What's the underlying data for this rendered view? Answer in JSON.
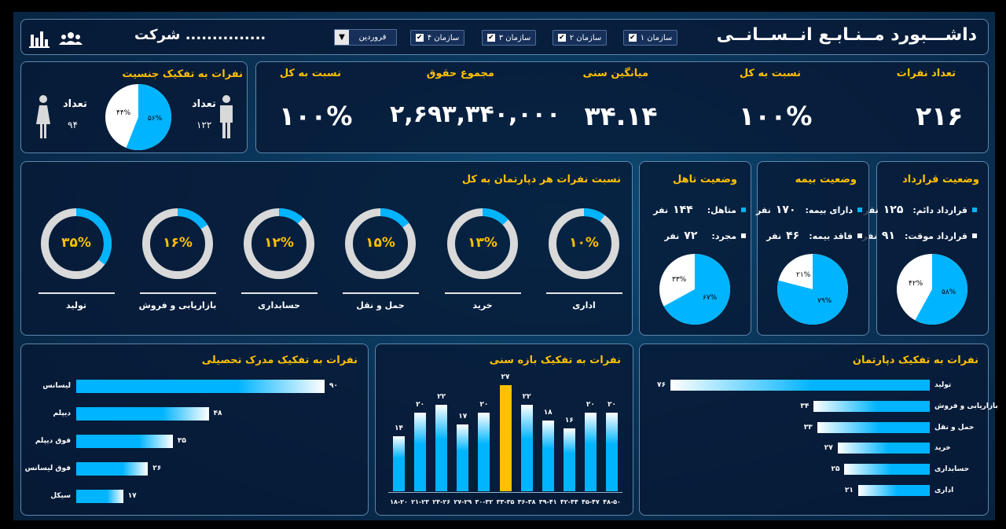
{
  "header": {
    "title": "داشـــبورد مــنـابـع انــســانــی",
    "company": "شرکت ...............",
    "org_filters": [
      {
        "label": "سازمان ۱"
      },
      {
        "label": "سازمان ۲"
      },
      {
        "label": "سازمان ۳"
      },
      {
        "label": "سازمان ۴"
      }
    ],
    "month": "فروردین",
    "icons": [
      "users-icon",
      "bar-chart-icon"
    ]
  },
  "gender": {
    "title": "نفرات به تفکیک جنسیت",
    "male_label": "تعداد",
    "male_count": "۱۲۲",
    "female_label": "تعداد",
    "female_count": "۹۴",
    "male_pct": "۵۶%",
    "female_pct": "۴۴%",
    "male_share": 0.56,
    "colors": {
      "male": "#00b4ff",
      "female": "#ffffff"
    }
  },
  "kpis": [
    {
      "label": "تعداد نفرات",
      "value": "۲۱۶"
    },
    {
      "label": "نسبت به کل",
      "value": "۱۰۰%"
    },
    {
      "label": "میانگین سنی",
      "value": "۳۴.۱۴"
    },
    {
      "label": "مجموع حقوق",
      "value": "۲,۶۹۳,۳۴۰,۰۰۰"
    },
    {
      "label": "نسبت به کل",
      "value": "۱۰۰%"
    }
  ],
  "departments_share": {
    "title": "نسبت نفرات هر دپارتمان به کل",
    "items": [
      {
        "label": "اداری",
        "pct": "۱۰%",
        "share": 0.1
      },
      {
        "label": "خرید",
        "pct": "۱۳%",
        "share": 0.13
      },
      {
        "label": "حمل و نقل",
        "pct": "۱۵%",
        "share": 0.15
      },
      {
        "label": "حسابداری",
        "pct": "۱۲%",
        "share": 0.12
      },
      {
        "label": "بازاریابی و فروش",
        "pct": "۱۶%",
        "share": 0.16
      },
      {
        "label": "تولید",
        "pct": "۳۵%",
        "share": 0.35
      }
    ]
  },
  "contract": {
    "title": "وضعیت قرارداد",
    "rows": [
      {
        "label": "قرارداد دائم:",
        "value": "۱۲۵",
        "unit": "نفر"
      },
      {
        "label": "قرارداد موقت:",
        "value": "۹۱",
        "unit": "نفر"
      }
    ],
    "pie": {
      "main_pct": "۵۸%",
      "rest_pct": "۴۲%",
      "main_share": 0.58
    }
  },
  "insurance": {
    "title": "وضعیت بیمه",
    "rows": [
      {
        "label": "دارای بیمه:",
        "value": "۱۷۰",
        "unit": "نفر"
      },
      {
        "label": "فاقد بیمه:",
        "value": "۴۶",
        "unit": "نفر"
      }
    ],
    "pie": {
      "main_pct": "۷۹%",
      "rest_pct": "۲۱%",
      "main_share": 0.79
    }
  },
  "marital": {
    "title": "وضعیت تاهل",
    "rows": [
      {
        "label": "متاهل:",
        "value": "۱۴۴",
        "unit": "نفر"
      },
      {
        "label": "مجرد:",
        "value": "۷۲",
        "unit": "نفر"
      }
    ],
    "pie": {
      "main_pct": "۶۷%",
      "rest_pct": "۳۳%",
      "main_share": 0.67
    }
  },
  "colors": {
    "accent": "#00b4ff",
    "gold": "#ffc000",
    "panel_border": "#5d86aa"
  },
  "chart_data": [
    {
      "type": "bar",
      "orientation": "horizontal",
      "title": "نفرات به تفکیک مدرک تحصیلی",
      "categories": [
        "لیسانس",
        "دیپلم",
        "فوق دیپلم",
        "فوق لیسانس",
        "سیکل"
      ],
      "values": [
        90,
        48,
        35,
        26,
        17
      ],
      "value_labels": [
        "۹۰",
        "۴۸",
        "۳۵",
        "۲۶",
        "۱۷"
      ]
    },
    {
      "type": "bar",
      "title": "نفرات به تفکیک بازه سنی",
      "categories": [
        "۱۸-۲۰",
        "۲۱-۲۳",
        "۲۴-۲۶",
        "۲۷-۲۹",
        "۳۰-۳۲",
        "۳۳-۳۵",
        "۳۶-۳۸",
        "۳۹-۴۱",
        "۴۲-۴۴",
        "۴۵-۴۷",
        "۴۸-۵۰"
      ],
      "values": [
        14,
        20,
        22,
        17,
        20,
        27,
        22,
        18,
        16,
        20,
        20
      ],
      "value_labels": [
        "۱۴",
        "۲۰",
        "۲۲",
        "۱۷",
        "۲۰",
        "۲۷",
        "۲۲",
        "۱۸",
        "۱۶",
        "۲۰",
        "۲۰"
      ],
      "highlight_index": 5
    },
    {
      "type": "bar",
      "orientation": "horizontal",
      "title": "نفرات به تفکیک دپارتمان",
      "categories": [
        "تولید",
        "بازاریابی و فروش",
        "حمل و نقل",
        "خرید",
        "حسابداری",
        "اداری"
      ],
      "values": [
        76,
        34,
        33,
        27,
        25,
        21
      ],
      "value_labels": [
        "۷۶",
        "۳۴",
        "۳۳",
        "۲۷",
        "۲۵",
        "۲۱"
      ]
    }
  ]
}
